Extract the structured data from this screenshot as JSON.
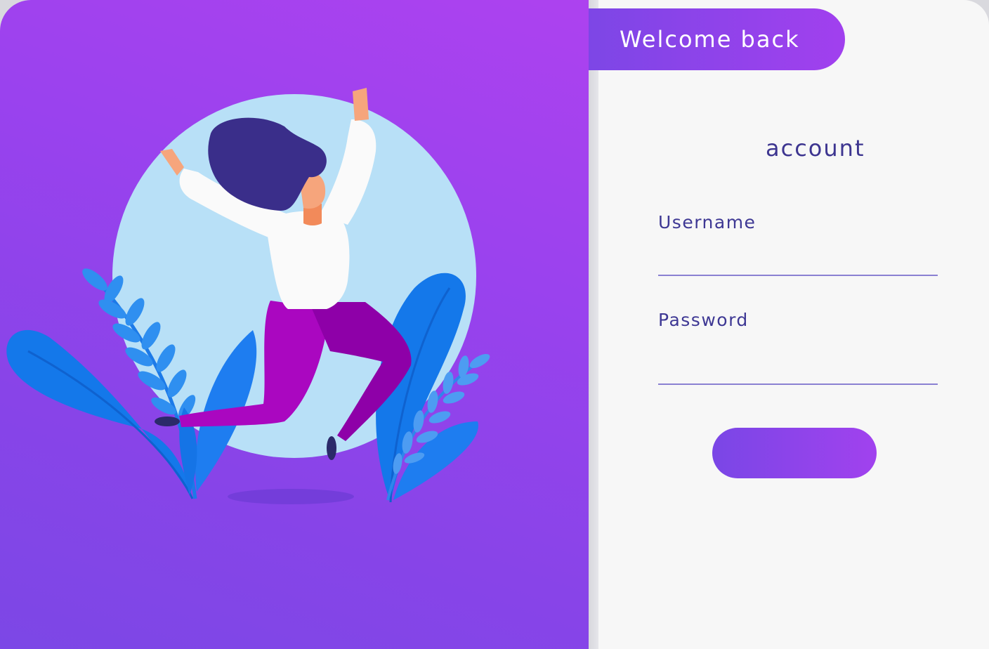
{
  "header": {
    "welcome_label": "Welcome back"
  },
  "form": {
    "title": "account",
    "username": {
      "label": "Username",
      "value": "",
      "placeholder": ""
    },
    "password": {
      "label": "Password",
      "value": "",
      "placeholder": ""
    },
    "submit_label": ""
  },
  "colors": {
    "panel_gradient_start": "#ad42ef",
    "panel_gradient_end": "#7c47e6",
    "form_background": "#f7f7f7",
    "text_primary": "#3d3590",
    "underline": "#8a80d2",
    "circle": "#b8e0f7",
    "leaf_blue": "#1478ea",
    "shirt": "#fafafa",
    "pants": "#aa07c0",
    "hair": "#3a2e8a"
  }
}
